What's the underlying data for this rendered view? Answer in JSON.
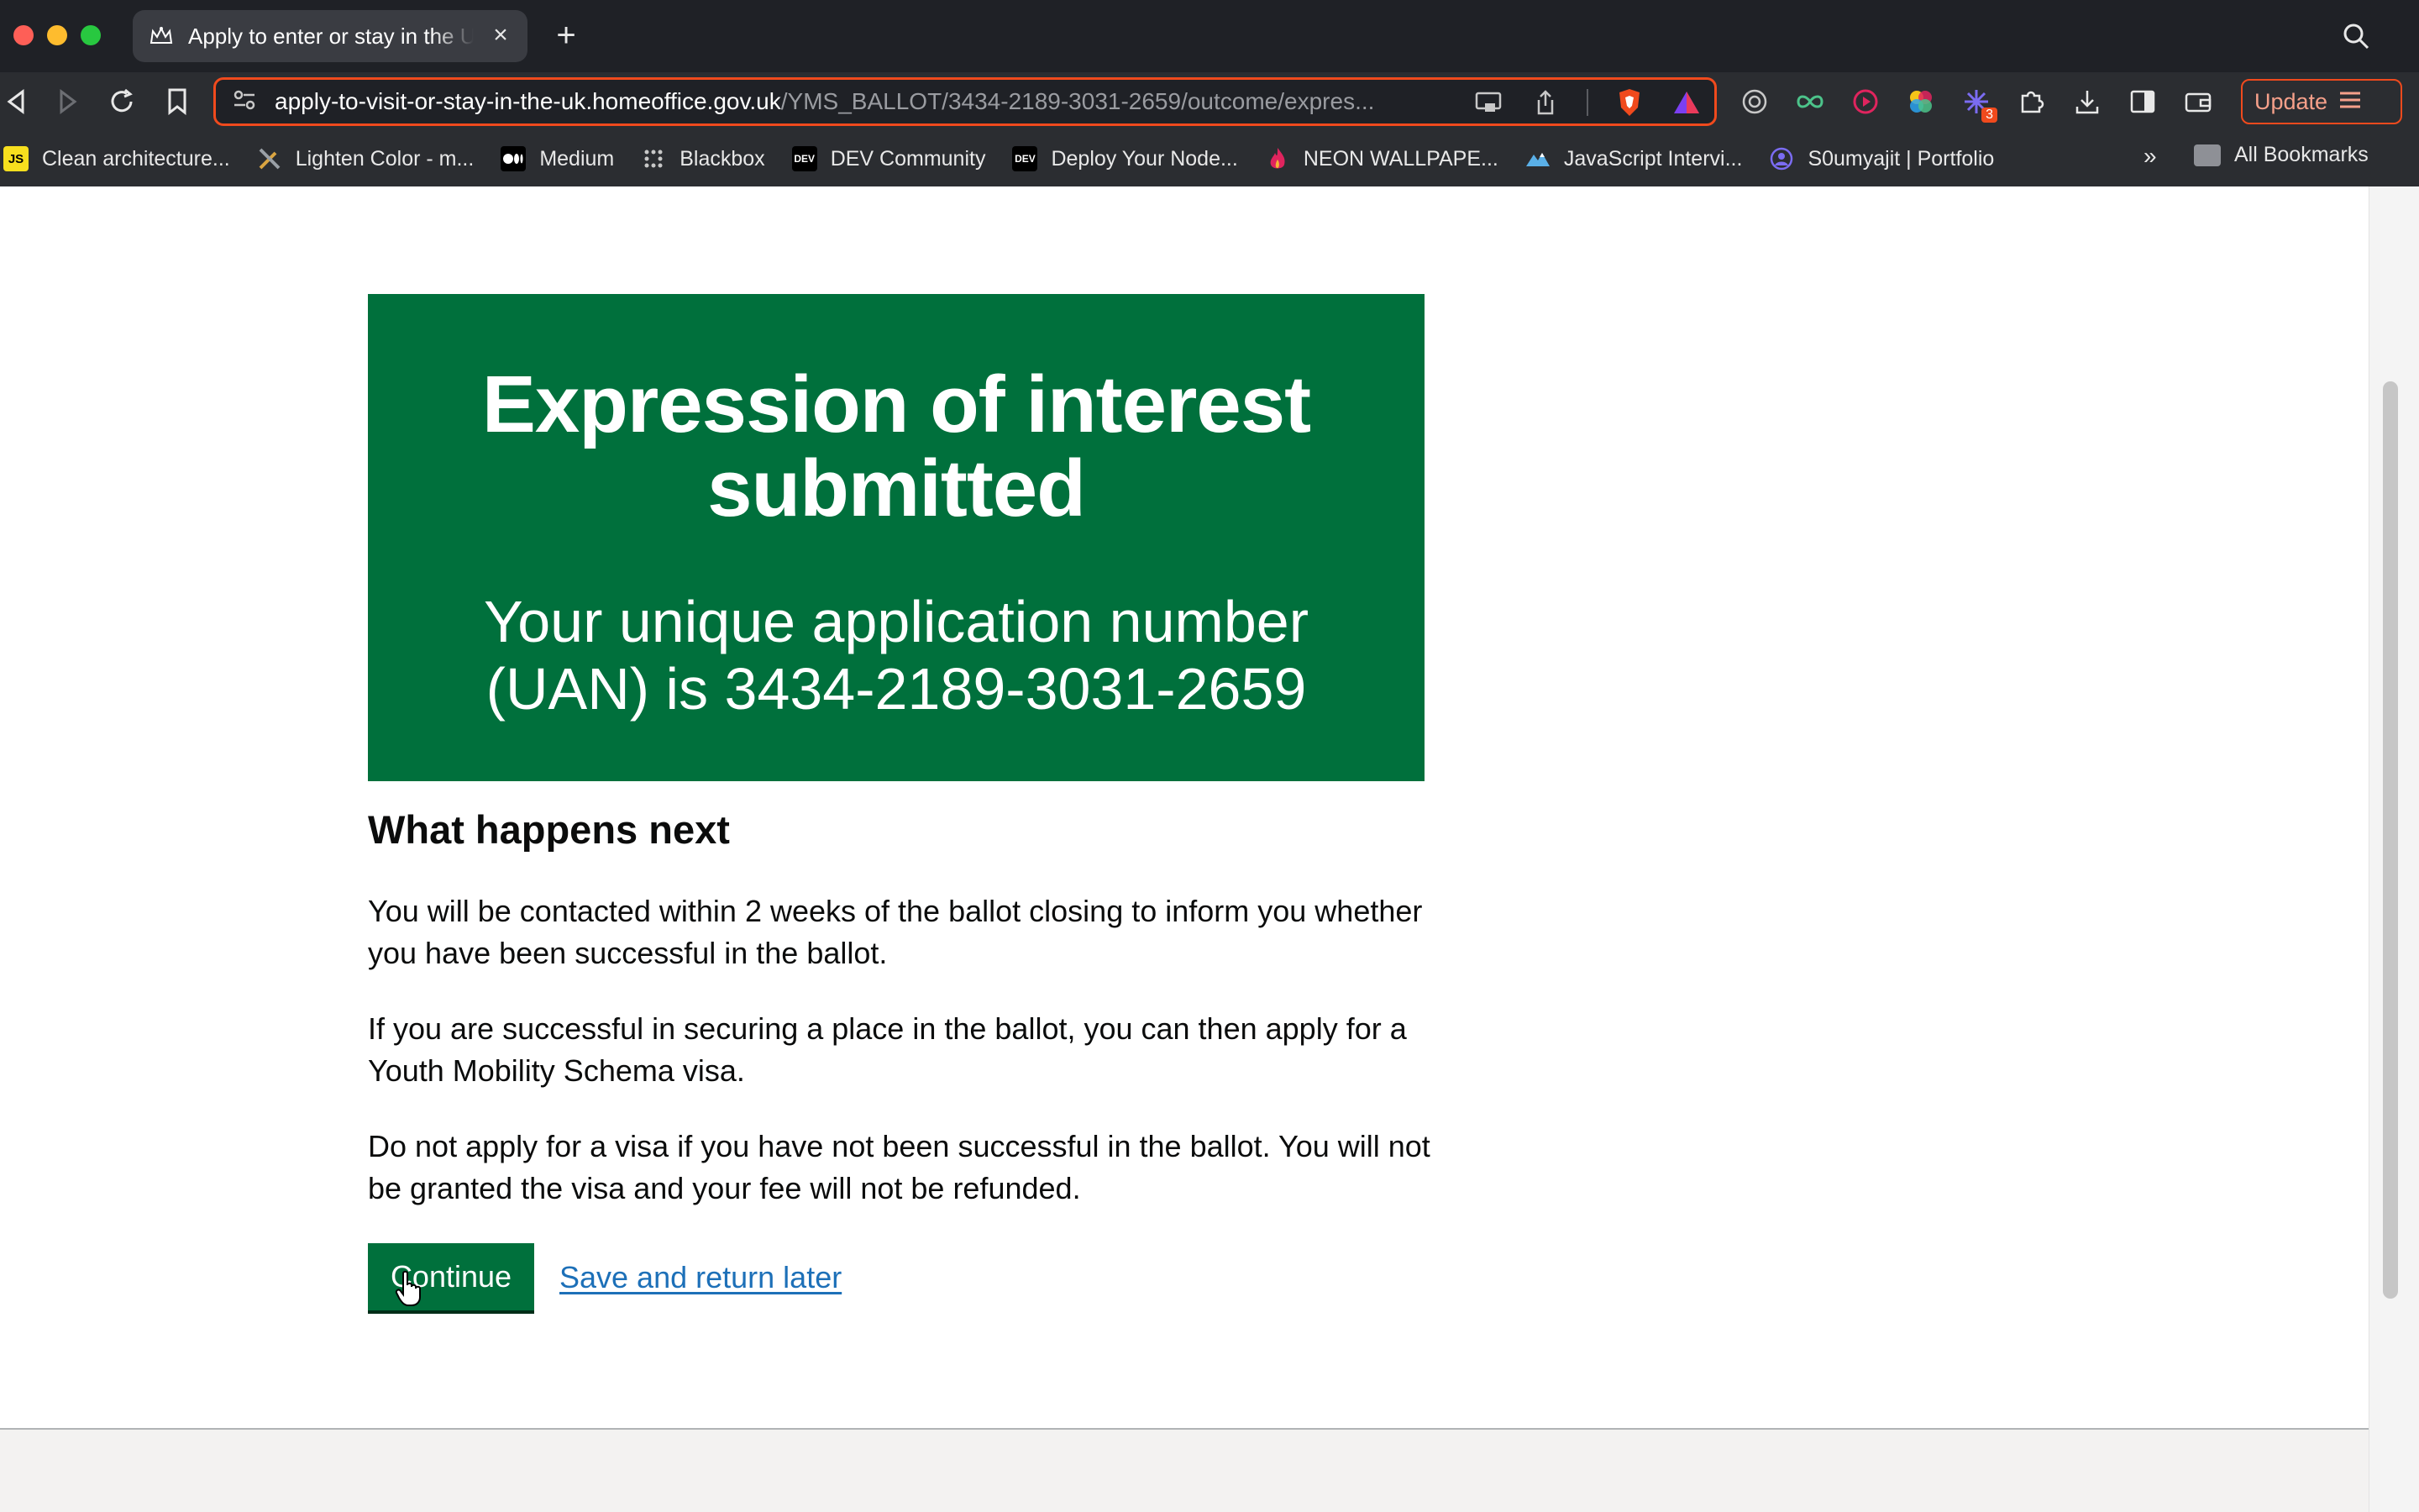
{
  "browser": {
    "tab_title": "Apply to enter or stay in the U",
    "url_domain": "apply-to-visit-or-stay-in-the-uk.homeoffice.gov.uk",
    "url_path": "/YMS_BALLOT/3434-2189-3031-2659/outcome/expres...",
    "update_label": "Update",
    "extension_badge": "3",
    "bookmarks": [
      {
        "label": "Clean architecture...",
        "icon": "js-icon"
      },
      {
        "label": "Lighten Color - m...",
        "icon": "tools-icon"
      },
      {
        "label": "Medium",
        "icon": "medium-icon"
      },
      {
        "label": "Blackbox",
        "icon": "blackbox-icon"
      },
      {
        "label": "DEV Community",
        "icon": "dev-icon"
      },
      {
        "label": "Deploy Your Node...",
        "icon": "dev-icon"
      },
      {
        "label": "NEON WALLPAPE...",
        "icon": "flame-icon"
      },
      {
        "label": "JavaScript Intervi...",
        "icon": "mountain-icon"
      },
      {
        "label": "S0umyajit | Portfolio",
        "icon": "avatar-icon"
      }
    ],
    "bookmarks_more": "»",
    "all_bookmarks": "All Bookmarks"
  },
  "page": {
    "panel_title": "Expression of interest submitted",
    "panel_body": "Your unique application number (UAN) is 3434-2189-3031-2659",
    "next_heading": "What happens next",
    "paragraphs": [
      "You will be contacted within 2 weeks of the ballot closing to inform you whether you have been successful in the ballot.",
      "If you are successful in securing a place in the ballot, you can then apply for a Youth Mobility Schema visa.",
      "Do not apply for a visa if you have not been successful in the ballot. You will not be granted the visa and your fee will not be refunded."
    ],
    "continue_label": "Continue",
    "save_link": "Save and return later"
  },
  "colors": {
    "govuk_green": "#00703c",
    "link_blue": "#1d70b8",
    "brave_orange": "#f04a1d"
  }
}
